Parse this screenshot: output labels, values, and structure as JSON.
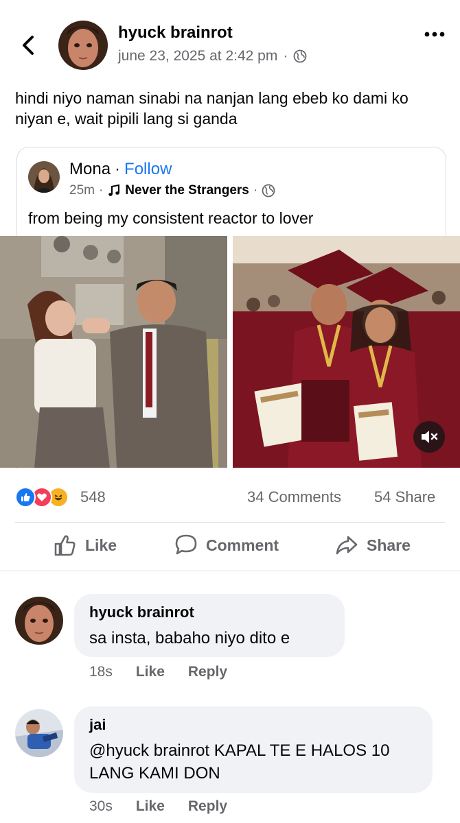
{
  "post": {
    "author": "hyuck brainrot",
    "timestamp": "june 23, 2025 at 2:42 pm",
    "meta_sep": "·",
    "privacy_icon": "globe-icon",
    "text": "hindi niyo naman sinabi na nanjan lang ebeb ko dami ko niyan e, wait pipili lang si ganda"
  },
  "shared": {
    "author": "Mona",
    "dot": "·",
    "follow_label": "Follow",
    "time": "25m",
    "music_icon": "music-note-icon",
    "music_title": "Never the Strangers",
    "text": "from being my consistent reactor to lover"
  },
  "stats": {
    "reaction_icons": [
      "like-icon",
      "love-icon",
      "haha-icon"
    ],
    "reaction_count": "548",
    "comments": "34 Comments",
    "shares": "54 Share"
  },
  "actions": {
    "like": "Like",
    "comment": "Comment",
    "share": "Share"
  },
  "comments": [
    {
      "name": "hyuck brainrot",
      "text": "sa insta, babaho niyo dito e",
      "time": "18s",
      "like": "Like",
      "reply": "Reply"
    },
    {
      "name": "jai",
      "text": "@hyuck brainrot KAPAL TE E HALOS 10 LANG KAMI DON",
      "time": "30s",
      "like": "Like",
      "reply": "Reply"
    }
  ],
  "colors": {
    "link": "#1877f2",
    "secondary_text": "#65676b",
    "bubble_bg": "#f0f2f5",
    "graduation_maroon": "#7a1420"
  }
}
